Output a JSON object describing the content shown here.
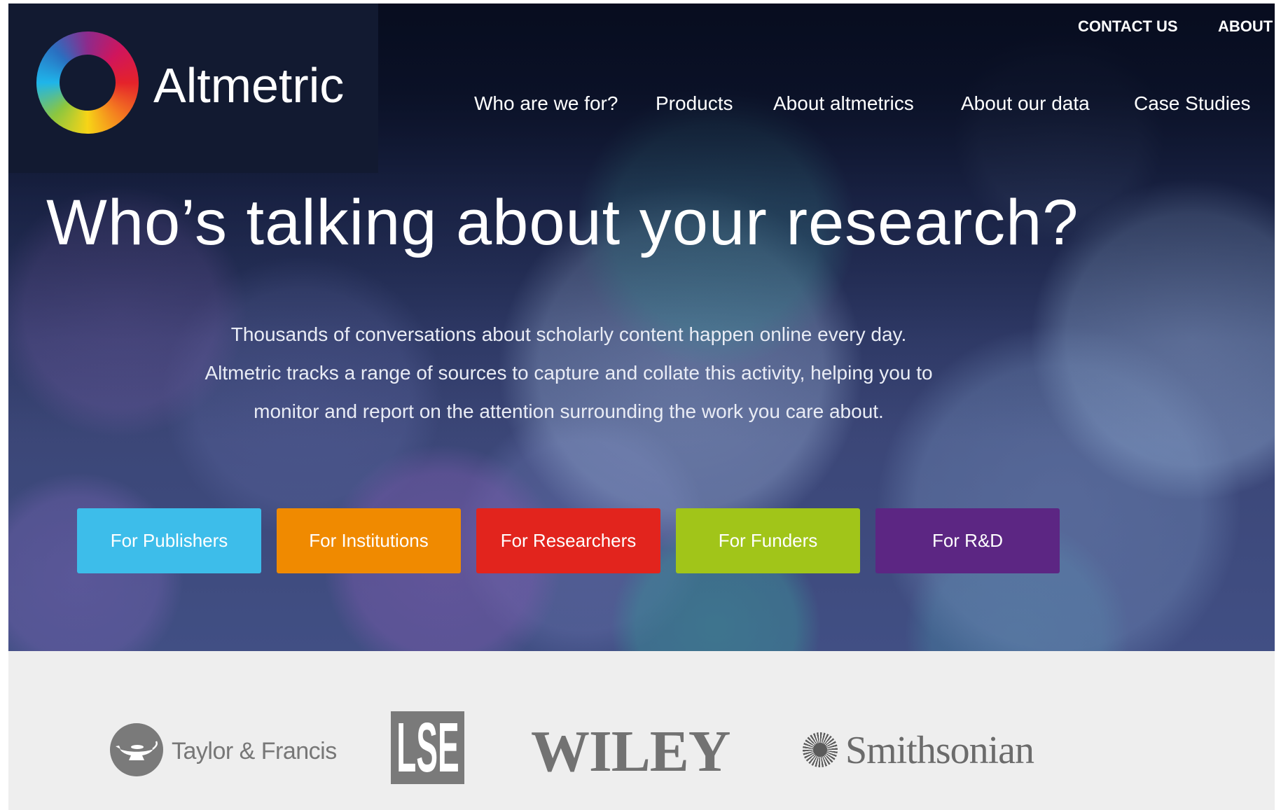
{
  "brand": {
    "name": "Altmetric",
    "logo_icon": "altmetric-donut-icon"
  },
  "utility_nav": [
    {
      "label": "CONTACT US"
    },
    {
      "label": "ABOUT"
    }
  ],
  "main_nav": [
    {
      "label": "Who are we for?"
    },
    {
      "label": "Products"
    },
    {
      "label": "About altmetrics"
    },
    {
      "label": "About our data"
    },
    {
      "label": "Case Studies"
    }
  ],
  "hero": {
    "headline": "Who’s talking about your research?",
    "paragraph_lines": [
      "Thousands of conversations about scholarly content happen online every day.",
      "Altmetric tracks a range of sources to capture and collate this activity, helping you to",
      "monitor and report on the attention surrounding the work you care about."
    ]
  },
  "audience_buttons": [
    {
      "label": "For Publishers",
      "color": "#3dbdea"
    },
    {
      "label": "For Institutions",
      "color": "#f08a00"
    },
    {
      "label": "For Researchers",
      "color": "#e2241d"
    },
    {
      "label": "For Funders",
      "color": "#a1c519"
    },
    {
      "label": "For R&D",
      "color": "#5c2683"
    }
  ],
  "partner_logos": [
    {
      "name": "Taylor & Francis",
      "icon": "oil-lamp-icon"
    },
    {
      "name": "LSE"
    },
    {
      "name": "WILEY"
    },
    {
      "name": "Smithsonian",
      "icon": "sunburst-icon"
    }
  ],
  "colors": {
    "partners_background": "#eeeeee",
    "hero_text": "#ffffff"
  }
}
